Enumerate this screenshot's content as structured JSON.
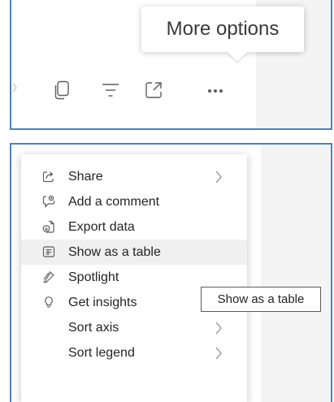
{
  "toolbar": {
    "tooltip": "More options",
    "icons": [
      "arrow-right-icon",
      "copy-icon",
      "filter-icon",
      "focus-mode-icon",
      "more-options-icon"
    ]
  },
  "context_menu": {
    "items": [
      {
        "label": "Share",
        "icon": "share-icon",
        "has_submenu": true
      },
      {
        "label": "Add a comment",
        "icon": "comment-icon",
        "has_submenu": false
      },
      {
        "label": "Export data",
        "icon": "export-icon",
        "has_submenu": false
      },
      {
        "label": "Show as a table",
        "icon": "table-icon",
        "has_submenu": false,
        "highlighted": true
      },
      {
        "label": "Spotlight",
        "icon": "spotlight-icon",
        "has_submenu": false
      },
      {
        "label": "Get insights",
        "icon": "lightbulb-icon",
        "has_submenu": false
      },
      {
        "label": "Sort axis",
        "icon": "",
        "has_submenu": true
      },
      {
        "label": "Sort legend",
        "icon": "",
        "has_submenu": true
      }
    ],
    "tooltip": "Show as a table"
  },
  "colors": {
    "panel_border": "#4f81bd",
    "highlight": "#f0f0f0",
    "text": "#252423",
    "icon": "#605e5c"
  }
}
